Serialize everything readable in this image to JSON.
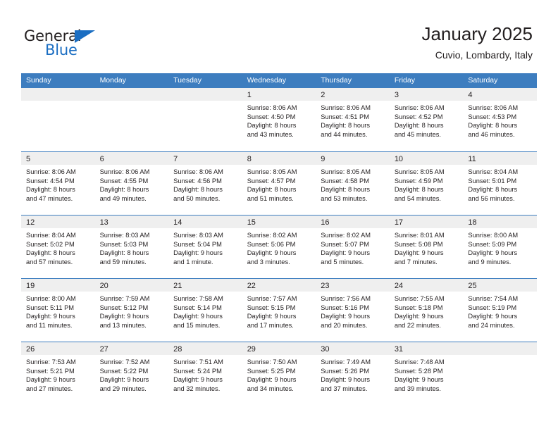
{
  "brand": {
    "name_top": "General",
    "name_bottom": "Blue",
    "accent_color": "#1b6ec2"
  },
  "header": {
    "title": "January 2025",
    "subtitle": "Cuvio, Lombardy, Italy"
  },
  "theme": {
    "header_row_bg": "#3d7dbf",
    "day_band_bg": "#efefef",
    "text_color": "#231f20"
  },
  "weekday_headers": [
    "Sunday",
    "Monday",
    "Tuesday",
    "Wednesday",
    "Thursday",
    "Friday",
    "Saturday"
  ],
  "weeks": [
    [
      {
        "day": "",
        "lines": []
      },
      {
        "day": "",
        "lines": []
      },
      {
        "day": "",
        "lines": []
      },
      {
        "day": "1",
        "lines": [
          "Sunrise: 8:06 AM",
          "Sunset: 4:50 PM",
          "Daylight: 8 hours",
          "and 43 minutes."
        ]
      },
      {
        "day": "2",
        "lines": [
          "Sunrise: 8:06 AM",
          "Sunset: 4:51 PM",
          "Daylight: 8 hours",
          "and 44 minutes."
        ]
      },
      {
        "day": "3",
        "lines": [
          "Sunrise: 8:06 AM",
          "Sunset: 4:52 PM",
          "Daylight: 8 hours",
          "and 45 minutes."
        ]
      },
      {
        "day": "4",
        "lines": [
          "Sunrise: 8:06 AM",
          "Sunset: 4:53 PM",
          "Daylight: 8 hours",
          "and 46 minutes."
        ]
      }
    ],
    [
      {
        "day": "5",
        "lines": [
          "Sunrise: 8:06 AM",
          "Sunset: 4:54 PM",
          "Daylight: 8 hours",
          "and 47 minutes."
        ]
      },
      {
        "day": "6",
        "lines": [
          "Sunrise: 8:06 AM",
          "Sunset: 4:55 PM",
          "Daylight: 8 hours",
          "and 49 minutes."
        ]
      },
      {
        "day": "7",
        "lines": [
          "Sunrise: 8:06 AM",
          "Sunset: 4:56 PM",
          "Daylight: 8 hours",
          "and 50 minutes."
        ]
      },
      {
        "day": "8",
        "lines": [
          "Sunrise: 8:05 AM",
          "Sunset: 4:57 PM",
          "Daylight: 8 hours",
          "and 51 minutes."
        ]
      },
      {
        "day": "9",
        "lines": [
          "Sunrise: 8:05 AM",
          "Sunset: 4:58 PM",
          "Daylight: 8 hours",
          "and 53 minutes."
        ]
      },
      {
        "day": "10",
        "lines": [
          "Sunrise: 8:05 AM",
          "Sunset: 4:59 PM",
          "Daylight: 8 hours",
          "and 54 minutes."
        ]
      },
      {
        "day": "11",
        "lines": [
          "Sunrise: 8:04 AM",
          "Sunset: 5:01 PM",
          "Daylight: 8 hours",
          "and 56 minutes."
        ]
      }
    ],
    [
      {
        "day": "12",
        "lines": [
          "Sunrise: 8:04 AM",
          "Sunset: 5:02 PM",
          "Daylight: 8 hours",
          "and 57 minutes."
        ]
      },
      {
        "day": "13",
        "lines": [
          "Sunrise: 8:03 AM",
          "Sunset: 5:03 PM",
          "Daylight: 8 hours",
          "and 59 minutes."
        ]
      },
      {
        "day": "14",
        "lines": [
          "Sunrise: 8:03 AM",
          "Sunset: 5:04 PM",
          "Daylight: 9 hours",
          "and 1 minute."
        ]
      },
      {
        "day": "15",
        "lines": [
          "Sunrise: 8:02 AM",
          "Sunset: 5:06 PM",
          "Daylight: 9 hours",
          "and 3 minutes."
        ]
      },
      {
        "day": "16",
        "lines": [
          "Sunrise: 8:02 AM",
          "Sunset: 5:07 PM",
          "Daylight: 9 hours",
          "and 5 minutes."
        ]
      },
      {
        "day": "17",
        "lines": [
          "Sunrise: 8:01 AM",
          "Sunset: 5:08 PM",
          "Daylight: 9 hours",
          "and 7 minutes."
        ]
      },
      {
        "day": "18",
        "lines": [
          "Sunrise: 8:00 AM",
          "Sunset: 5:09 PM",
          "Daylight: 9 hours",
          "and 9 minutes."
        ]
      }
    ],
    [
      {
        "day": "19",
        "lines": [
          "Sunrise: 8:00 AM",
          "Sunset: 5:11 PM",
          "Daylight: 9 hours",
          "and 11 minutes."
        ]
      },
      {
        "day": "20",
        "lines": [
          "Sunrise: 7:59 AM",
          "Sunset: 5:12 PM",
          "Daylight: 9 hours",
          "and 13 minutes."
        ]
      },
      {
        "day": "21",
        "lines": [
          "Sunrise: 7:58 AM",
          "Sunset: 5:14 PM",
          "Daylight: 9 hours",
          "and 15 minutes."
        ]
      },
      {
        "day": "22",
        "lines": [
          "Sunrise: 7:57 AM",
          "Sunset: 5:15 PM",
          "Daylight: 9 hours",
          "and 17 minutes."
        ]
      },
      {
        "day": "23",
        "lines": [
          "Sunrise: 7:56 AM",
          "Sunset: 5:16 PM",
          "Daylight: 9 hours",
          "and 20 minutes."
        ]
      },
      {
        "day": "24",
        "lines": [
          "Sunrise: 7:55 AM",
          "Sunset: 5:18 PM",
          "Daylight: 9 hours",
          "and 22 minutes."
        ]
      },
      {
        "day": "25",
        "lines": [
          "Sunrise: 7:54 AM",
          "Sunset: 5:19 PM",
          "Daylight: 9 hours",
          "and 24 minutes."
        ]
      }
    ],
    [
      {
        "day": "26",
        "lines": [
          "Sunrise: 7:53 AM",
          "Sunset: 5:21 PM",
          "Daylight: 9 hours",
          "and 27 minutes."
        ]
      },
      {
        "day": "27",
        "lines": [
          "Sunrise: 7:52 AM",
          "Sunset: 5:22 PM",
          "Daylight: 9 hours",
          "and 29 minutes."
        ]
      },
      {
        "day": "28",
        "lines": [
          "Sunrise: 7:51 AM",
          "Sunset: 5:24 PM",
          "Daylight: 9 hours",
          "and 32 minutes."
        ]
      },
      {
        "day": "29",
        "lines": [
          "Sunrise: 7:50 AM",
          "Sunset: 5:25 PM",
          "Daylight: 9 hours",
          "and 34 minutes."
        ]
      },
      {
        "day": "30",
        "lines": [
          "Sunrise: 7:49 AM",
          "Sunset: 5:26 PM",
          "Daylight: 9 hours",
          "and 37 minutes."
        ]
      },
      {
        "day": "31",
        "lines": [
          "Sunrise: 7:48 AM",
          "Sunset: 5:28 PM",
          "Daylight: 9 hours",
          "and 39 minutes."
        ]
      },
      {
        "day": "",
        "lines": []
      }
    ]
  ]
}
